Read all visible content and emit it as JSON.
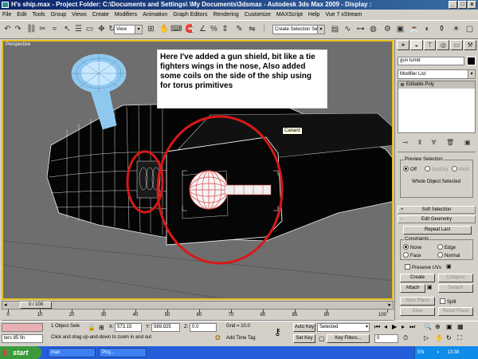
{
  "window": {
    "title": "H's ship.max    - Project Folder: C:\\Documents and Settings\\  \\My Documents\\3dsmax    - Autodesk 3ds Max  2009       - Display :",
    "min": "_",
    "max": "□",
    "close": "x"
  },
  "menu": [
    "File",
    "Edit",
    "Tools",
    "Group",
    "Views",
    "Create",
    "Modifiers",
    "Animation",
    "Graph Editors",
    "Rendering",
    "Customize",
    "MAXScript",
    "Help",
    "Vue 7 xStream"
  ],
  "toolbar": {
    "view_combo": "View",
    "selection_set_placeholder": "Create Selection Se"
  },
  "viewport": {
    "label": "Perspective",
    "annotation": "Here I've added a gun shield, bit like a tie fighters wings in the nose, Also added some coils on the side of the ship using for torus primitives",
    "tooltip": "Canard",
    "accent": "#e8c020"
  },
  "command_panel": {
    "object_name": "gun turret",
    "modifier_list": "Modifier List",
    "stack_items": [
      "Editable Poly"
    ],
    "preview_selection": {
      "title": "Preview Selection",
      "options": [
        "Off",
        "SubObj",
        "Multi"
      ]
    },
    "whole_object_selected": "Whole Object Selected",
    "soft_selection": "Soft Selection",
    "edit_geometry": "Edit Geometry",
    "repeat_last": "Repeat Last",
    "constraints": {
      "title": "Constraints",
      "options": [
        "None",
        "Edge",
        "Face",
        "Normal"
      ]
    },
    "preserve_uvs": "Preserve UVs",
    "buttons": {
      "create": "Create",
      "collapse": "Collapse",
      "attach": "Attach",
      "detach": "Detach",
      "slice_plane": "Slice Plane",
      "split": "Split",
      "slice": "Slice",
      "reset_plane": "Reset Plane"
    }
  },
  "timeline": {
    "frame": "0 / 100",
    "ticks": [
      "0",
      "10",
      "20",
      "30",
      "40",
      "50",
      "60",
      "70",
      "80",
      "85",
      "90",
      "100"
    ]
  },
  "status": {
    "maxscript_listener": "ters 85 fin",
    "object_count": "1 Object Sele",
    "x": "573.15",
    "y": "569.925",
    "z": "0.0",
    "grid": "Grid = 10.0",
    "prompt": "Click and drag up-and-down to zoom in and out",
    "add_time_tag": "Add Time Tag",
    "auto_key": "Auto Key",
    "auto_key_value": "Selected",
    "set_key": "Set Key",
    "key_filters": "Key Filters...",
    "frame_number": "0"
  },
  "taskbar": {
    "start": "start",
    "items": [
      "max",
      "Proj..."
    ],
    "lang": "EN",
    "time": "13:38"
  }
}
